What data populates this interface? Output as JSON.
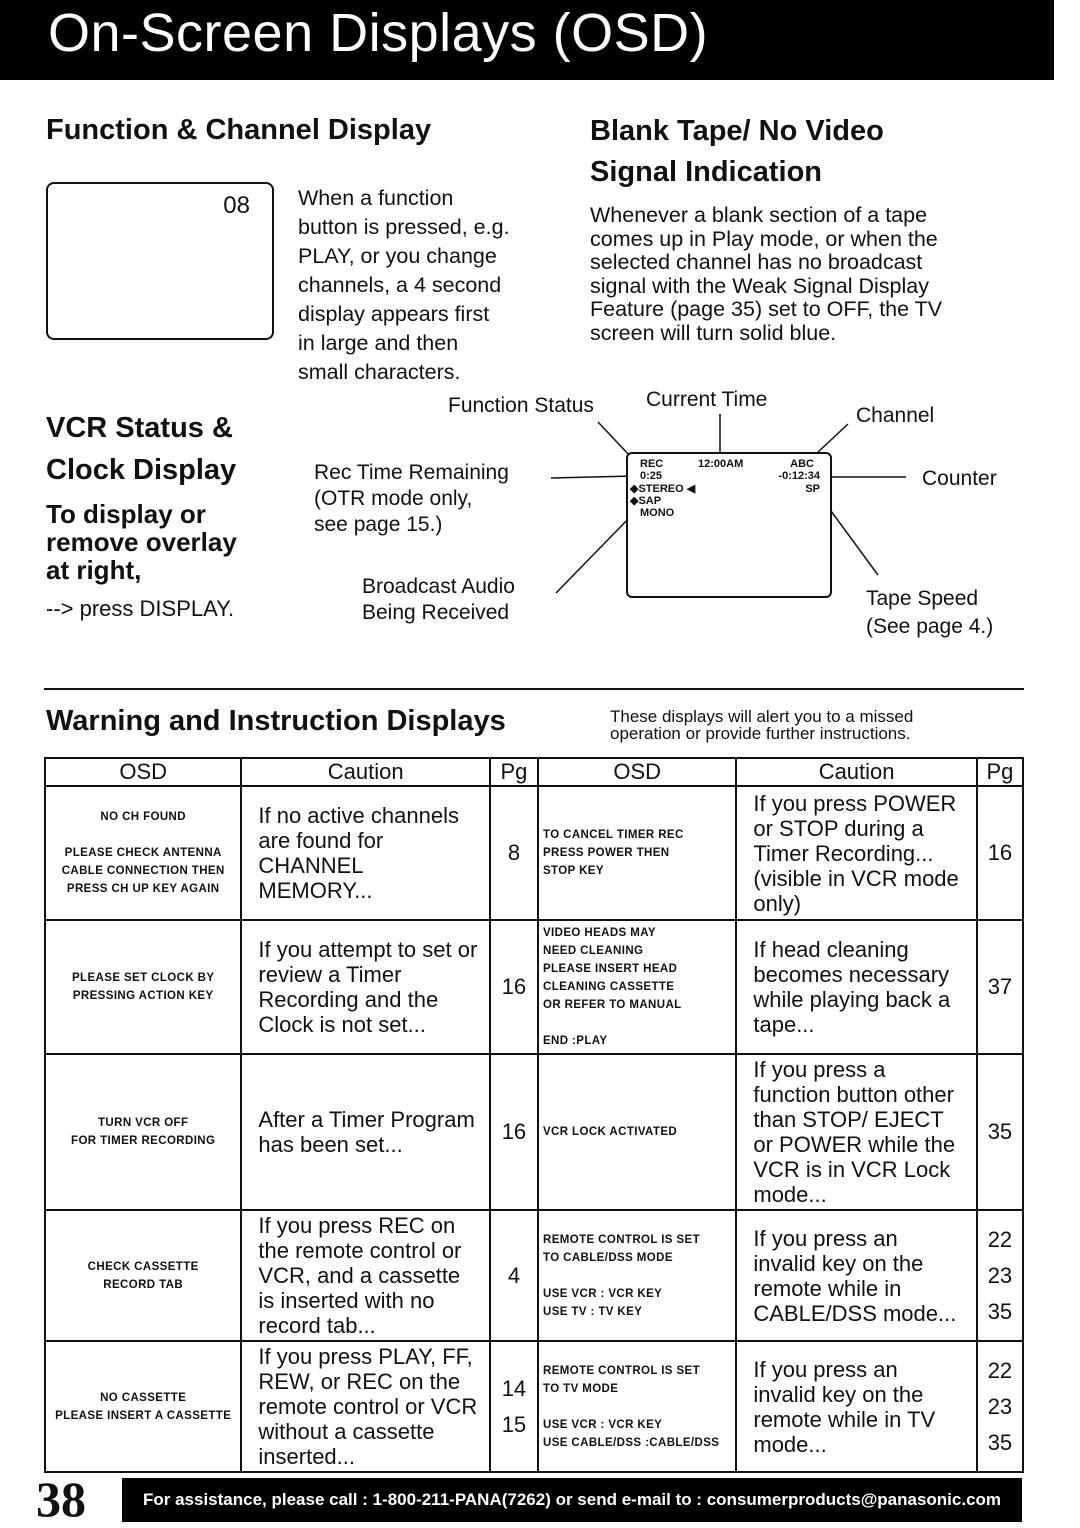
{
  "header": {
    "title": "On-Screen Displays (OSD)"
  },
  "function_channel": {
    "heading": "Function & Channel Display",
    "screen_channel": "08",
    "description": [
      "When a function",
      "button is pressed, e.g.",
      "PLAY, or you change",
      "channels, a 4 second",
      "display appears first",
      "in large and then",
      "small characters."
    ]
  },
  "blank_tape": {
    "heading_line1": "Blank Tape/ No Video",
    "heading_line2": "Signal Indication",
    "description": [
      "Whenever a blank section of a tape",
      "comes up in Play mode, or when the",
      "selected channel has no broadcast",
      "signal with the Weak Signal Display",
      "Feature (page 35) set to OFF, the TV",
      "screen will turn solid blue."
    ]
  },
  "vcr_status": {
    "heading_line1": "VCR Status &",
    "heading_line2": "Clock Display",
    "subheading": [
      "To display or",
      "remove overlay",
      "at right,"
    ],
    "instruction": "--> press DISPLAY.",
    "labels": {
      "function_status": "Function Status",
      "current_time": "Current Time",
      "channel": "Channel",
      "rec_time": [
        "Rec Time Remaining",
        "(OTR mode only,",
        "see page 15.)"
      ],
      "counter": "Counter",
      "broadcast_audio": [
        "Broadcast Audio",
        "Being Received"
      ],
      "tape_speed": [
        "Tape Speed",
        "(See page 4.)"
      ]
    },
    "screen": {
      "function": "REC",
      "time": "12:00AM",
      "channel": "ABC",
      "rec_remaining": "0:25",
      "counter": "-0:12:34",
      "stereo": "STEREO",
      "sap": "SAP",
      "mono": "MONO",
      "speed": "SP"
    }
  },
  "warnings": {
    "heading": "Warning and Instruction Displays",
    "note": [
      "These displays will alert you to a missed",
      "operation or provide further instructions."
    ],
    "columns": [
      "OSD",
      "Caution",
      "Pg"
    ],
    "left_rows": [
      {
        "osd": [
          "NO CH FOUND",
          "",
          "PLEASE CHECK ANTENNA",
          "CABLE CONNECTION THEN",
          "PRESS CH UP KEY AGAIN"
        ],
        "caution": "If no active channels are found for CHANNEL MEMORY...",
        "pg": [
          "8"
        ]
      },
      {
        "osd": [
          "PLEASE SET CLOCK BY",
          "PRESSING ACTION KEY"
        ],
        "caution": "If you attempt to set or review a Timer Recording and the Clock is not set...",
        "pg": [
          "16"
        ]
      },
      {
        "osd": [
          "TURN VCR OFF",
          "FOR TIMER RECORDING"
        ],
        "caution": "After a Timer Program has been set...",
        "pg": [
          "16"
        ]
      },
      {
        "osd": [
          "CHECK CASSETTE",
          "RECORD TAB"
        ],
        "caution": "If you press REC on the remote control or VCR, and a cassette is inserted with no record tab...",
        "pg": [
          "4"
        ]
      },
      {
        "osd": [
          "NO CASSETTE",
          "PLEASE INSERT A CASSETTE"
        ],
        "caution": "If you press PLAY, FF, REW, or REC on the remote control or VCR without a cassette inserted...",
        "pg": [
          "14",
          "15"
        ]
      }
    ],
    "right_rows": [
      {
        "osd": [
          "TO CANCEL TIMER REC",
          "PRESS POWER THEN",
          "STOP KEY"
        ],
        "caution": "If you press POWER or STOP during a Timer Recording... (visible in VCR mode only)",
        "pg": [
          "16"
        ]
      },
      {
        "osd": [
          "VIDEO HEADS MAY",
          "NEED CLEANING",
          "PLEASE INSERT HEAD",
          "CLEANING CASSETTE",
          "OR REFER TO MANUAL",
          "",
          "END      :PLAY"
        ],
        "caution": "If head cleaning becomes necessary while playing back a tape...",
        "pg": [
          "37"
        ]
      },
      {
        "osd": [
          "VCR LOCK ACTIVATED"
        ],
        "caution": "If you press a function button other than STOP/ EJECT or POWER while the VCR is in VCR Lock mode...",
        "pg": [
          "35"
        ]
      },
      {
        "osd": [
          "REMOTE CONTROL IS SET",
          "TO CABLE/DSS MODE",
          "",
          "USE VCR :  VCR KEY",
          "USE TV    :  TV KEY"
        ],
        "caution": "If you press an invalid key on the remote while in CABLE/DSS mode...",
        "pg": [
          "22",
          "23",
          "35"
        ]
      },
      {
        "osd": [
          "REMOTE CONTROL IS SET",
          "TO TV MODE",
          "",
          "USE VCR : VCR KEY",
          "USE CABLE/DSS :CABLE/DSS"
        ],
        "caution": "If you press an invalid key on the remote while in TV mode...",
        "pg": [
          "22",
          "23",
          "35"
        ]
      }
    ]
  },
  "footer": {
    "page_number": "38",
    "assistance": "For assistance, please call : 1-800-211-PANA(7262) or send e-mail to : consumerproducts@panasonic.com"
  }
}
